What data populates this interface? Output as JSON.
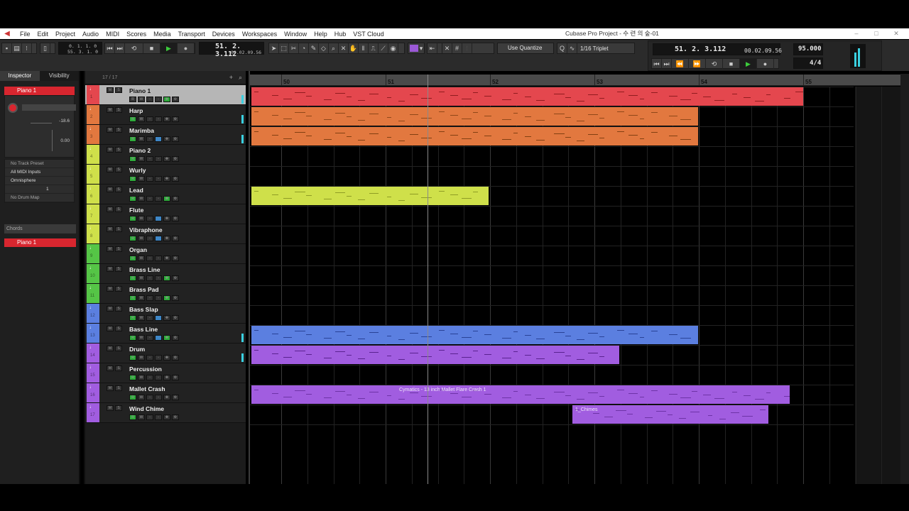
{
  "menubar": {
    "items": [
      "File",
      "Edit",
      "Project",
      "Audio",
      "MIDI",
      "Scores",
      "Media",
      "Transport",
      "Devices",
      "Workspaces",
      "Window",
      "Help",
      "Hub",
      "VST Cloud"
    ],
    "title": "Cubase Pro Project - 수 련 의 숲-01"
  },
  "toolbar": {
    "left_position_primary": "0. 1. 1.  0",
    "left_position_secondary": "55. 3. 1.  0",
    "main_position": "51. 2. 3.112",
    "main_time": "00.02.09.56",
    "quantize_mode": "Use Quantize",
    "quantize_value": "1/16 Triplet"
  },
  "transport": {
    "position": "51. 2. 3.112",
    "time": "00.02.09.56",
    "tempo": "95.000",
    "signature": "4/4"
  },
  "inspector": {
    "tabs": [
      "Inspector",
      "Visibility"
    ],
    "track_name": "Piano 1",
    "volume": "-18.6",
    "pan": "0.00",
    "track_preset": "No Track Preset",
    "midi_input": "All MIDI Inputs",
    "instrument": "Omnisphere",
    "channel": "1",
    "drum_map": "No Drum Map",
    "chords_label": "Chords",
    "bottom_track": "Piano 1"
  },
  "tracklist": {
    "count": "17 / 17",
    "tracks": [
      {
        "name": "Piano 1",
        "num": "1"
      },
      {
        "name": "Harp",
        "num": "2"
      },
      {
        "name": "Marimba",
        "num": "3"
      },
      {
        "name": "Piano 2",
        "num": "4"
      },
      {
        "name": "Wurly",
        "num": "5"
      },
      {
        "name": "Lead",
        "num": "6"
      },
      {
        "name": "Flute",
        "num": "7"
      },
      {
        "name": "Vibraphone",
        "num": "8"
      },
      {
        "name": "Organ",
        "num": "9"
      },
      {
        "name": "Brass Line",
        "num": "10"
      },
      {
        "name": "Brass Pad",
        "num": "11"
      },
      {
        "name": "Bass Slap",
        "num": "12"
      },
      {
        "name": "Bass Line",
        "num": "13"
      },
      {
        "name": "Drum",
        "num": "14"
      },
      {
        "name": "Percussion",
        "num": "15"
      },
      {
        "name": "Mallet Crash",
        "num": "16"
      },
      {
        "name": "Wind Chime",
        "num": "17"
      }
    ]
  },
  "ruler": {
    "bars": [
      "50",
      "51",
      "52",
      "53",
      "54",
      "55"
    ]
  },
  "parts": {
    "mallet_crash_label": "Cymatics - 13 inch Mallet Flare Crash 1",
    "wind_chime_label": "1_Chimes"
  },
  "colors": {
    "piano": "#e4474e",
    "orange": "#e2783f",
    "lime": "#cfe04a",
    "blue": "#5b7fe0",
    "purple": "#a15de0"
  }
}
